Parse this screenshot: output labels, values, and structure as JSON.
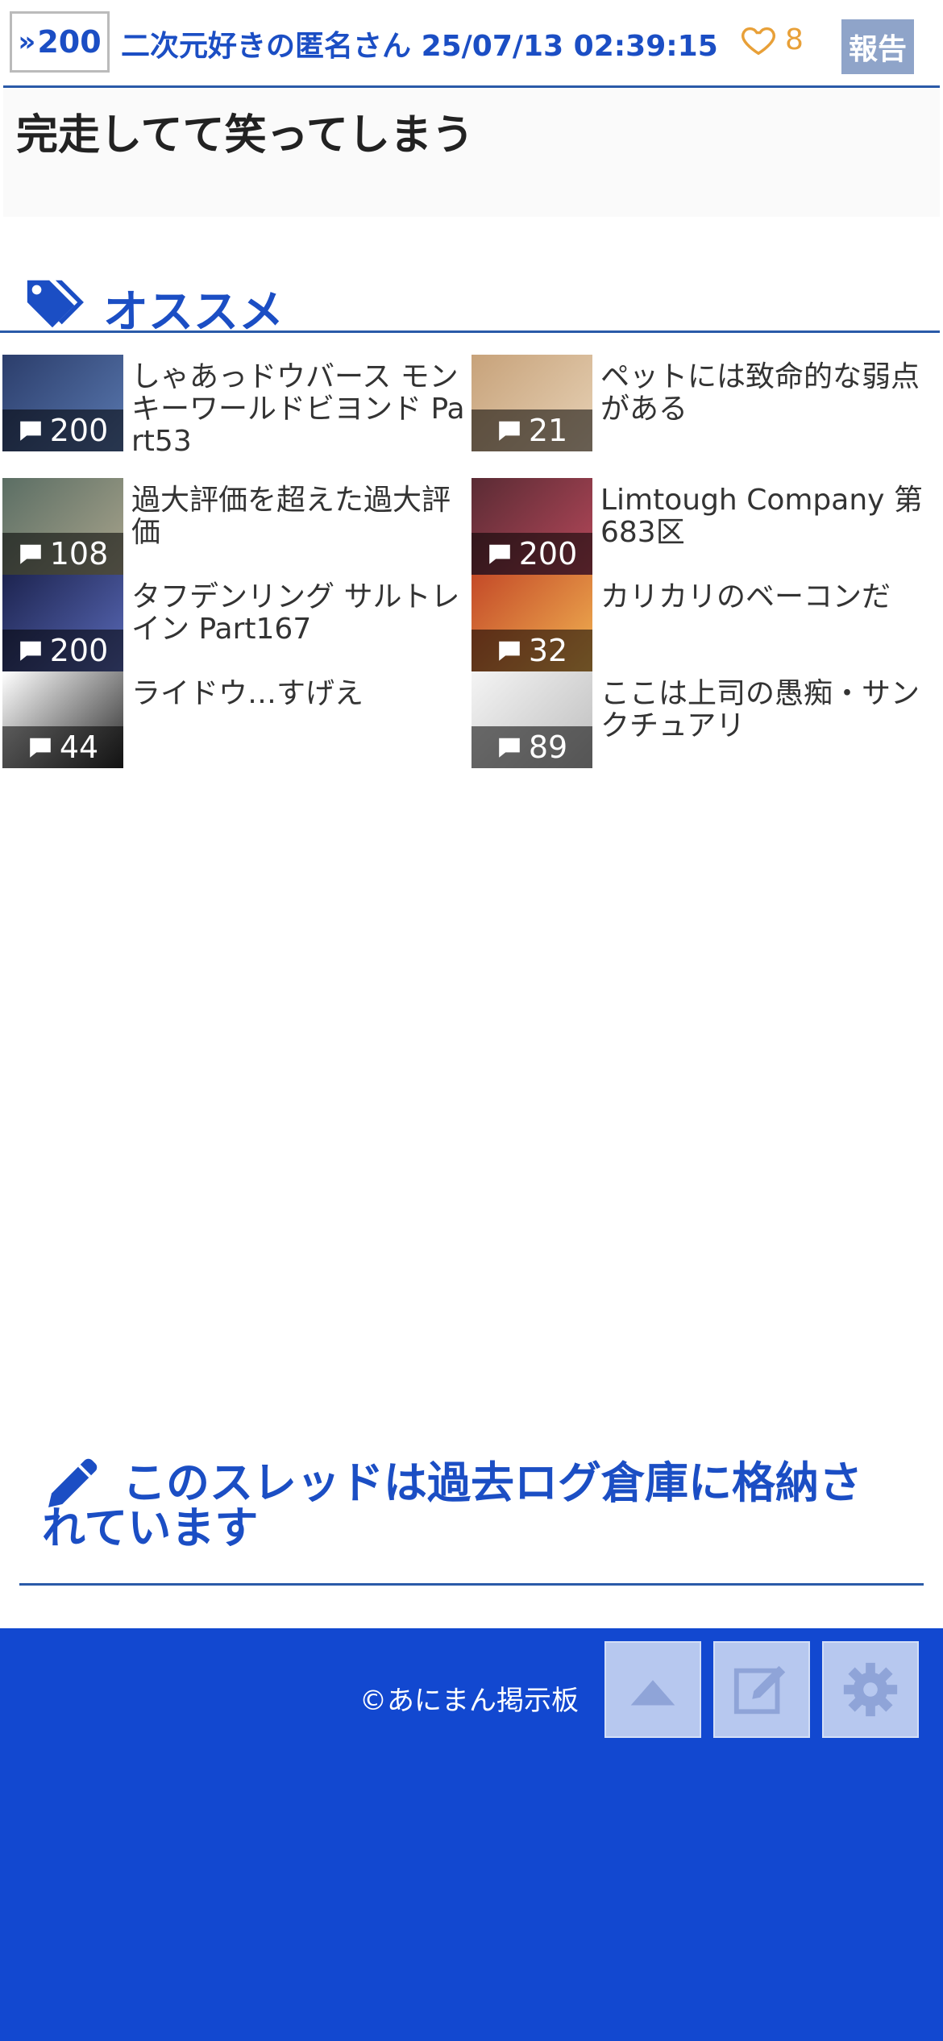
{
  "post": {
    "number": "200",
    "author": "二次元好きの匿名さん",
    "datetime": "25/07/13 02:39:15",
    "likes": "8",
    "report_label": "報告",
    "text": "完走してて笑ってしまう"
  },
  "recommend": {
    "title": "オススメ",
    "items": [
      {
        "title": "しゃあっドウバース モンキーワールドビヨンド Part53",
        "count": "200",
        "thumb_colors": [
          "#2b3d6b",
          "#5a79b0"
        ]
      },
      {
        "title": "ペットには致命的な弱点がある",
        "count": "21",
        "thumb_colors": [
          "#c7a27a",
          "#e7d2b6"
        ]
      },
      {
        "title": "過大評価を超えた過大評価",
        "count": "108",
        "thumb_colors": [
          "#5b6e64",
          "#a9a48c"
        ]
      },
      {
        "title": "Limtough Company 第683区",
        "count": "200",
        "thumb_colors": [
          "#5a2b34",
          "#b6485a"
        ]
      },
      {
        "title": "タフデンリング サルトレイン Part167",
        "count": "200",
        "thumb_colors": [
          "#1d2450",
          "#5a6ab8"
        ]
      },
      {
        "title": "カリカリのベーコンだ",
        "count": "32",
        "thumb_colors": [
          "#c44a28",
          "#f1b352"
        ]
      },
      {
        "title": "ライドウ…すげえ",
        "count": "44",
        "thumb_colors": [
          "#ffffff",
          "#2a2a2a"
        ]
      },
      {
        "title": "ここは上司の愚痴・サンクチュアリ",
        "count": "89",
        "thumb_colors": [
          "#f4f4f4",
          "#bdbdbd"
        ]
      }
    ]
  },
  "archive_notice": "このスレッドは過去ログ倉庫に格納されています",
  "footer": {
    "copyright": "©あにまん掲示板"
  },
  "colors": {
    "brand_blue": "#1b4ec4",
    "footer_blue": "#1248d0",
    "like_orange": "#e8a038"
  }
}
